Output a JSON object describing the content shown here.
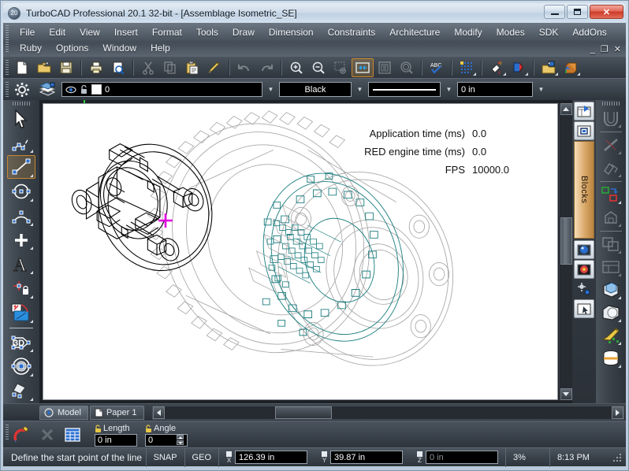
{
  "window": {
    "title": "TurboCAD Professional 20.1 32-bit - [Assemblage Isometric_SE]",
    "app_icon": "turbocad-logo-icon",
    "minimize_label": "Minimize",
    "maximize_label": "Maximize",
    "close_label": "✕"
  },
  "menu": {
    "row1": [
      "File",
      "Edit",
      "View",
      "Insert",
      "Format",
      "Tools",
      "Draw",
      "Dimension",
      "Constraints",
      "Architecture",
      "Modify",
      "Modes",
      "SDK",
      "AddOns"
    ],
    "row2": [
      "Ruby",
      "Options",
      "Window",
      "Help"
    ],
    "mdi": [
      "_",
      "❐",
      "✕"
    ]
  },
  "toolbar": {
    "items": [
      {
        "name": "new-file",
        "label": "New"
      },
      {
        "name": "open-file",
        "label": "Open"
      },
      {
        "name": "save-file",
        "label": "Save"
      },
      {
        "name": "print",
        "label": "Print"
      },
      {
        "name": "print-preview",
        "label": "Print Preview"
      },
      {
        "name": "cut",
        "label": "Cut"
      },
      {
        "name": "copy",
        "label": "Copy"
      },
      {
        "name": "paste",
        "label": "Paste"
      },
      {
        "name": "format-painter",
        "label": "Format Painter"
      },
      {
        "name": "undo",
        "label": "Undo"
      },
      {
        "name": "redo",
        "label": "Redo"
      },
      {
        "name": "zoom-in",
        "label": "Zoom In"
      },
      {
        "name": "zoom-out",
        "label": "Zoom Out"
      },
      {
        "name": "zoom-window",
        "label": "Zoom Window"
      },
      {
        "name": "zoom-extents",
        "label": "Zoom Extents"
      },
      {
        "name": "zoom-page",
        "label": "Zoom Page"
      },
      {
        "name": "zoom-previous",
        "label": "Zoom Previous"
      },
      {
        "name": "spell-check",
        "label": "Spell Check"
      },
      {
        "name": "snap-grid",
        "label": "Grid"
      },
      {
        "name": "paint-snap",
        "label": "Snap Options"
      },
      {
        "name": "render",
        "label": "Render"
      },
      {
        "name": "open-workspace",
        "label": "Workspace"
      },
      {
        "name": "isometric-view",
        "label": "Isometric View"
      }
    ]
  },
  "propbar": {
    "settings_label": "Properties",
    "layers_label": "Layers",
    "layer": {
      "visible_icon": "eye-icon",
      "lock_icon": "unlock-icon",
      "color_swatch": "#ffffff",
      "name": "0"
    },
    "color": "Black",
    "linestyle": "Continuous",
    "linewidth": "0 in"
  },
  "left_toolbar": {
    "items": [
      {
        "name": "select-tool",
        "label": "Select",
        "active": false
      },
      {
        "name": "polyline-tool",
        "label": "Polyline",
        "active": false
      },
      {
        "name": "line-tool",
        "label": "Line",
        "active": true
      },
      {
        "name": "circle-tool",
        "label": "Circle",
        "active": false
      },
      {
        "name": "arc-tool",
        "label": "Arc",
        "active": false
      },
      {
        "name": "point-tool",
        "label": "Point",
        "active": false
      },
      {
        "name": "text-tool",
        "label": "Text",
        "active": false
      },
      {
        "name": "constraint-tool",
        "label": "Constraint",
        "active": false
      },
      {
        "name": "hatch-fill-tool",
        "label": "Hatch / Fill",
        "active": false
      },
      {
        "name": "3d-tool",
        "label": "3D Objects",
        "active": false
      },
      {
        "name": "solid-tool",
        "label": "Solid Primitives",
        "active": false
      },
      {
        "name": "render-tool",
        "label": "Render Material",
        "active": false
      }
    ]
  },
  "right_panel": {
    "blocks_tab_label": "Blocks",
    "tabs": [
      {
        "name": "design-director-tab",
        "label": "Design Director"
      },
      {
        "name": "blocks-selector-tab",
        "label": "Blocks Selector"
      },
      {
        "name": "library-palette-tab",
        "label": "Library Palette"
      },
      {
        "name": "materials-palette-tab",
        "label": "Materials Palette"
      },
      {
        "name": "properties-palette-tab",
        "label": "Properties Palette"
      },
      {
        "name": "selection-info-tab",
        "label": "Selection Info"
      }
    ],
    "tools": [
      {
        "name": "extrude-tool",
        "label": "Extrude",
        "disabled": true
      },
      {
        "name": "trim-tool",
        "label": "Trim",
        "disabled": true
      },
      {
        "name": "mirror-tool",
        "label": "Mirror",
        "disabled": true
      },
      {
        "name": "copy-entity-tool",
        "label": "Copy Entity",
        "disabled": false
      },
      {
        "name": "explode-tool",
        "label": "Explode",
        "disabled": true
      },
      {
        "name": "boolean-tool",
        "label": "Boolean",
        "disabled": true
      },
      {
        "name": "align-tool",
        "label": "Align",
        "disabled": true
      },
      {
        "name": "shell-tool",
        "label": "Shell",
        "disabled": false
      },
      {
        "name": "sphere-tool",
        "label": "Sphere",
        "disabled": false
      },
      {
        "name": "material-brush-tool",
        "label": "Material Brush",
        "disabled": false
      },
      {
        "name": "cylinder-tool",
        "label": "Cylinder",
        "disabled": false
      }
    ]
  },
  "canvas": {
    "overlay": [
      {
        "label": "Application time (ms)",
        "value": "0.0"
      },
      {
        "label": "RED engine time (ms)",
        "value": "0.0"
      },
      {
        "label": "FPS",
        "value": "10000.0"
      }
    ],
    "cursor_color": "#e000e0",
    "colors": {
      "black_part": "#000000",
      "gray_part": "#a8a8a8",
      "teal_part": "#1f7f80"
    }
  },
  "sheet_tabs": [
    {
      "name": "model-tab",
      "label": "Model",
      "active": true
    },
    {
      "name": "paper1-tab",
      "label": "Paper 1",
      "active": false
    }
  ],
  "coordbar": {
    "snap_tool_label": "Snap Magnet",
    "clear_label": "Clear",
    "table_label": "Coordinate Table",
    "length_label": "Length",
    "length_value": "0 in",
    "angle_label": "Angle",
    "angle_value": "0"
  },
  "statusbar": {
    "message": "Define the start point of the line",
    "snap": "SNAP",
    "geo": "GEO",
    "x_label": "X",
    "x_value": "126.39 in",
    "y_label": "Y",
    "y_value": "39.87 in",
    "z_label": "Z",
    "z_value": "0 in",
    "zoom": "3%",
    "time": "8:13 PM"
  }
}
